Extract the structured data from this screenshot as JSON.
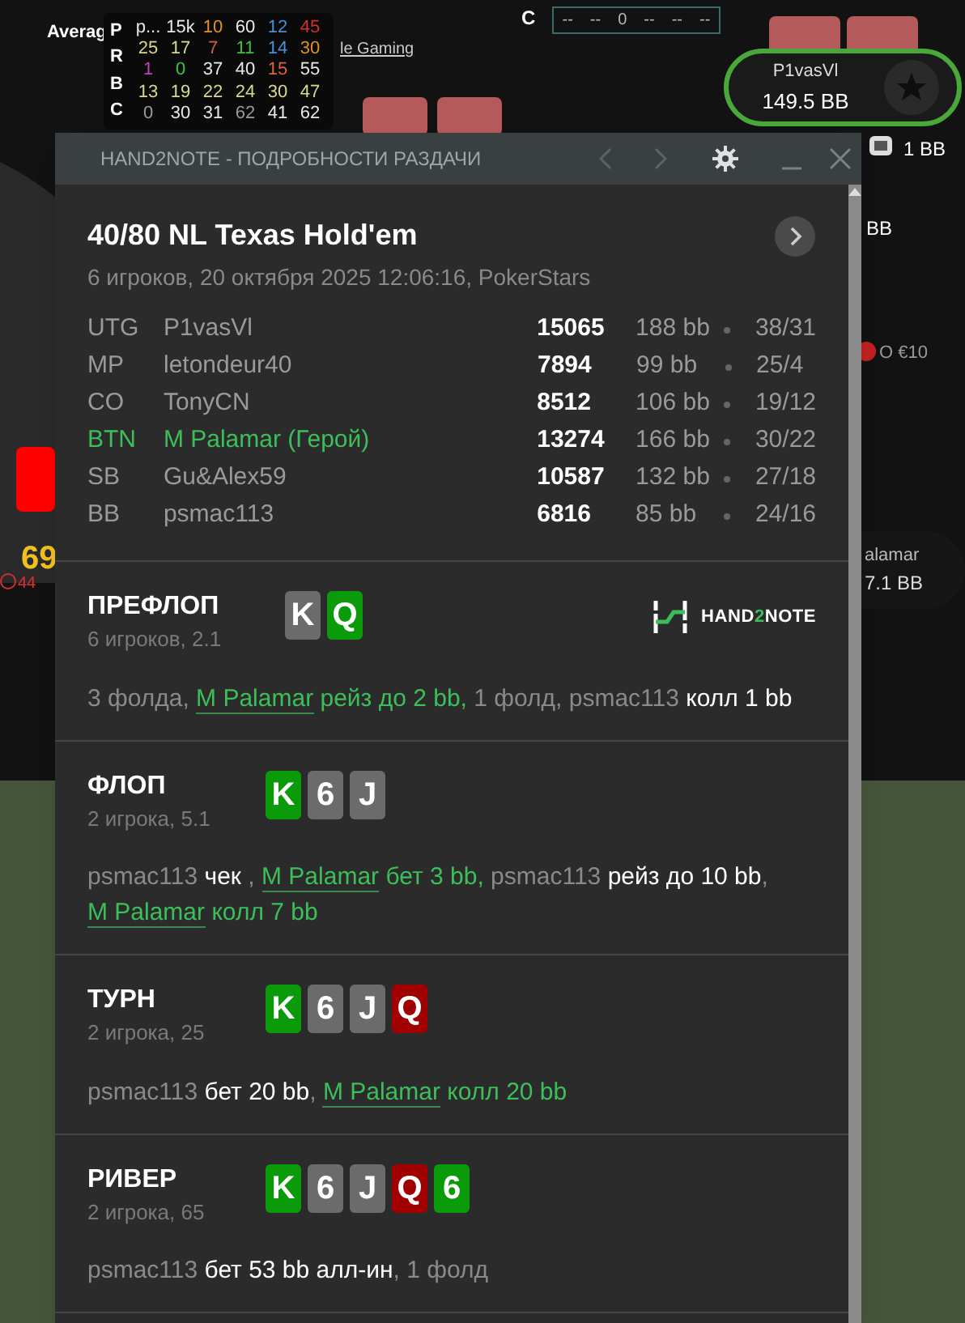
{
  "table": {
    "hud": {
      "row_labels": [
        "P",
        "R",
        "B",
        "C"
      ],
      "rows": [
        [
          {
            "text": "p...",
            "color": "#e8e8e8"
          },
          {
            "text": "15k",
            "color": "#e8e8e8"
          },
          {
            "text": "10",
            "color": "#e0902a"
          },
          {
            "text": "60",
            "color": "#e8e8e8"
          },
          {
            "text": "12",
            "color": "#4a8fd8"
          },
          {
            "text": "45",
            "color": "#d03030"
          }
        ],
        [
          {
            "text": "25",
            "color": "#d8d890"
          },
          {
            "text": "17",
            "color": "#d8d890"
          },
          {
            "text": "7",
            "color": "#d06040"
          },
          {
            "text": "11",
            "color": "#40c040"
          },
          {
            "text": "14",
            "color": "#4a8fd8"
          },
          {
            "text": "30",
            "color": "#e0902a"
          }
        ],
        [
          {
            "text": "1",
            "color": "#c040c0"
          },
          {
            "text": "0",
            "color": "#40c040"
          },
          {
            "text": "37",
            "color": "#e8e8e8"
          },
          {
            "text": "40",
            "color": "#e8e8e8"
          },
          {
            "text": "15",
            "color": "#e06040"
          },
          {
            "text": "55",
            "color": "#e8e8e8"
          }
        ],
        [
          {
            "text": "13",
            "color": "#d8d890"
          },
          {
            "text": "19",
            "color": "#d8d890"
          },
          {
            "text": "22",
            "color": "#d8d890"
          },
          {
            "text": "24",
            "color": "#d8d890"
          },
          {
            "text": "30",
            "color": "#d8d890"
          },
          {
            "text": "47",
            "color": "#d8d890"
          }
        ],
        [
          {
            "text": "0",
            "color": "#9a9a9a"
          },
          {
            "text": "30",
            "color": "#e8e8e8"
          },
          {
            "text": "31",
            "color": "#e8e8e8"
          },
          {
            "text": "62",
            "color": "#9a9a9a"
          },
          {
            "text": "41",
            "color": "#e8e8e8"
          },
          {
            "text": "62",
            "color": "#e8e8e8"
          }
        ]
      ]
    },
    "hud2_row": [
      "--",
      "--",
      "0",
      "--",
      "--",
      "--"
    ],
    "average_label": "Averag",
    "gaming_label": "le Gaming",
    "c_label": "C",
    "seat": {
      "name": "P1vasVl",
      "stack": "149.5 BB"
    },
    "blind": "1 BB",
    "right_bb": "BB",
    "promo": "O €10",
    "hero_seat": {
      "name": "alamar",
      "stack": "7.1 BB"
    },
    "left_stack": "69",
    "left_count": "44"
  },
  "window": {
    "title": "HAND2NOTE - ПОДРОБНОСТИ РАЗДАЧИ",
    "game": "40/80 NL Texas Hold'em",
    "info": "6 игроков, 20 октября 2025 12:06:16, PokerStars",
    "players": [
      {
        "position": "UTG",
        "name": "P1vasVl",
        "stack": "15065",
        "bb": "188 bb",
        "stat": "38/31",
        "selected": false
      },
      {
        "position": "MP",
        "name": "letondeur40",
        "stack": "7894",
        "bb": "99 bb",
        "stat": "25/4",
        "selected": false
      },
      {
        "position": "CO",
        "name": "TonyCN",
        "stack": "8512",
        "bb": "106 bb",
        "stat": "19/12",
        "selected": false
      },
      {
        "position": "BTN",
        "name": "M Palamar (Герой)",
        "stack": "13274",
        "bb": "166 bb",
        "stat": "30/22",
        "selected": true
      },
      {
        "position": "SB",
        "name": "Gu&Alex59",
        "stack": "10587",
        "bb": "132 bb",
        "stat": "27/18",
        "selected": false
      },
      {
        "position": "BB",
        "name": "psmac113",
        "stack": "6816",
        "bb": "85 bb",
        "stat": "24/16",
        "selected": false
      }
    ],
    "logo": {
      "before": "HAND",
      "accent": "2",
      "after": "NOTE"
    },
    "streets": [
      {
        "name": "ПРЕФЛОП",
        "sub": "6 игроков, 2.1",
        "cards": [
          {
            "rank": "K",
            "color": "#6b6b6b"
          },
          {
            "rank": "Q",
            "color": "#0a9a0a"
          }
        ],
        "actions": [
          {
            "kind": "plain",
            "text": "3 фолда, "
          },
          {
            "kind": "hero",
            "text": "M Palamar"
          },
          {
            "kind": "hero_action",
            "text": " рейз до 2 bb,"
          },
          {
            "kind": "plain",
            "text": " 1 фолд, psmac113 "
          },
          {
            "kind": "action",
            "text": "колл 1 bb"
          }
        ]
      },
      {
        "name": "ФЛОП",
        "sub": "2 игрока, 5.1",
        "cards": [
          {
            "rank": "K",
            "color": "#0a9a0a"
          },
          {
            "rank": "6",
            "color": "#6b6b6b"
          },
          {
            "rank": "J",
            "color": "#6b6b6b"
          }
        ],
        "actions": [
          {
            "kind": "plain",
            "text": "psmac113 "
          },
          {
            "kind": "action",
            "text": "чек"
          },
          {
            "kind": "plain",
            "text": " , "
          },
          {
            "kind": "hero",
            "text": "M Palamar"
          },
          {
            "kind": "hero_action",
            "text": " бет 3 bb,"
          },
          {
            "kind": "plain",
            "text": " psmac113 "
          },
          {
            "kind": "action",
            "text": "рейз до 10 bb"
          },
          {
            "kind": "plain",
            "text": ", "
          },
          {
            "kind": "hero",
            "text": "M Palamar"
          },
          {
            "kind": "hero_action",
            "text": " колл 7 bb"
          }
        ]
      },
      {
        "name": "ТУРН",
        "sub": "2 игрока, 25",
        "cards": [
          {
            "rank": "K",
            "color": "#0a9a0a"
          },
          {
            "rank": "6",
            "color": "#6b6b6b"
          },
          {
            "rank": "J",
            "color": "#6b6b6b"
          },
          {
            "rank": "Q",
            "color": "#a00000"
          }
        ],
        "actions": [
          {
            "kind": "plain",
            "text": "psmac113 "
          },
          {
            "kind": "action",
            "text": "бет 20 bb"
          },
          {
            "kind": "plain",
            "text": ", "
          },
          {
            "kind": "hero",
            "text": "M Palamar"
          },
          {
            "kind": "hero_action",
            "text": " колл 20 bb"
          }
        ]
      },
      {
        "name": "РИВЕР",
        "sub": "2 игрока, 65",
        "cards": [
          {
            "rank": "K",
            "color": "#0a9a0a"
          },
          {
            "rank": "6",
            "color": "#6b6b6b"
          },
          {
            "rank": "J",
            "color": "#6b6b6b"
          },
          {
            "rank": "Q",
            "color": "#a00000"
          },
          {
            "rank": "6",
            "color": "#0a9a0a"
          }
        ],
        "actions": [
          {
            "kind": "plain",
            "text": "psmac113 "
          },
          {
            "kind": "action",
            "text": "бет 53 bb алл-ин"
          },
          {
            "kind": "plain",
            "text": ", 1 фолд"
          }
        ]
      }
    ]
  }
}
